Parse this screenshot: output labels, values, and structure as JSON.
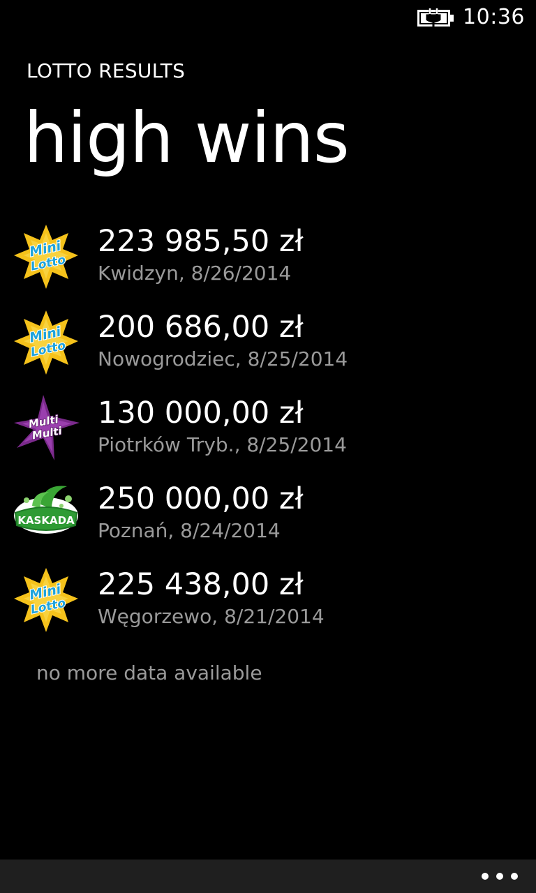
{
  "status_bar": {
    "battery_icon": "battery-charging-icon",
    "time": "10:36"
  },
  "header": {
    "app_title": "LOTTO RESULTS",
    "page_title": "high wins"
  },
  "wins": [
    {
      "game": "Mini Lotto",
      "logo_icon": "mini-lotto-logo-icon",
      "logo_text": [
        "Mini",
        "Lotto"
      ],
      "amount": "223 985,50 zł",
      "details": "Kwidzyn, 8/26/2014"
    },
    {
      "game": "Mini Lotto",
      "logo_icon": "mini-lotto-logo-icon",
      "logo_text": [
        "Mini",
        "Lotto"
      ],
      "amount": "200 686,00 zł",
      "details": "Nowogrodziec, 8/25/2014"
    },
    {
      "game": "Multi Multi",
      "logo_icon": "multi-multi-logo-icon",
      "logo_text": [
        "Multi",
        "Multi"
      ],
      "amount": "130 000,00 zł",
      "details": "Piotrków Tryb., 8/25/2014"
    },
    {
      "game": "Kaskada",
      "logo_icon": "kaskada-logo-icon",
      "logo_text": [
        "KASKADA"
      ],
      "amount": "250 000,00 zł",
      "details": "Poznań, 8/24/2014"
    },
    {
      "game": "Mini Lotto",
      "logo_icon": "mini-lotto-logo-icon",
      "logo_text": [
        "Mini",
        "Lotto"
      ],
      "amount": "225 438,00 zł",
      "details": "Węgorzewo, 8/21/2014"
    }
  ],
  "footer_message": "no more data available",
  "app_bar": {
    "more_icon": "ellipsis-icon"
  },
  "colors": {
    "background": "#000000",
    "primary_text": "#ffffff",
    "secondary_text": "#9a9a9a",
    "app_bar": "#1f1f1f",
    "mini_lotto_yellow": "#f5c21b",
    "mini_lotto_blue": "#1fa3dc",
    "multi_multi_purple": "#7b2a8c",
    "kaskada_green": "#3aa535"
  }
}
